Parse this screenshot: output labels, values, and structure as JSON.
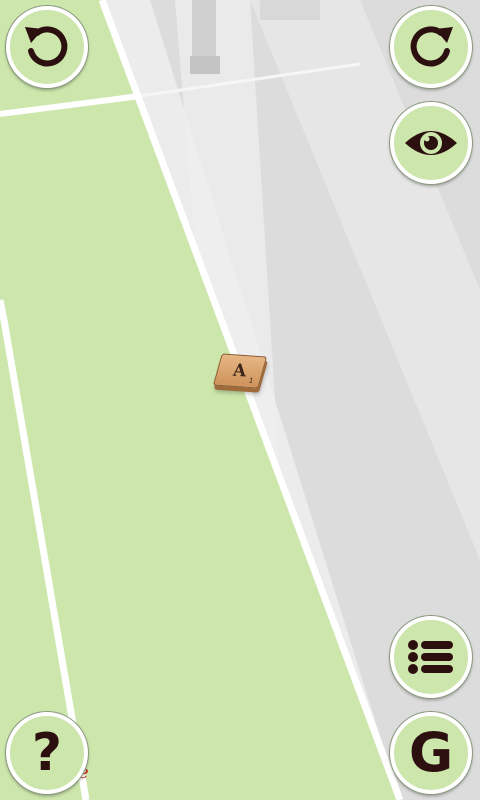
{
  "board": {
    "tile": {
      "letter": "A",
      "score": "1"
    },
    "corner_mark": "e"
  },
  "controls": {
    "undo_icon": "undo-icon",
    "redo_icon": "redo-icon",
    "view_icon": "eye-icon",
    "menu_icon": "list-icon",
    "help_label": "?",
    "g_label": "G"
  },
  "colors": {
    "board_green": "#cde6ac",
    "board_grey": "#ececec",
    "line_white": "#ffffff",
    "icon_dark": "#2c0f0f",
    "tile_wood": "#d9a56f"
  }
}
